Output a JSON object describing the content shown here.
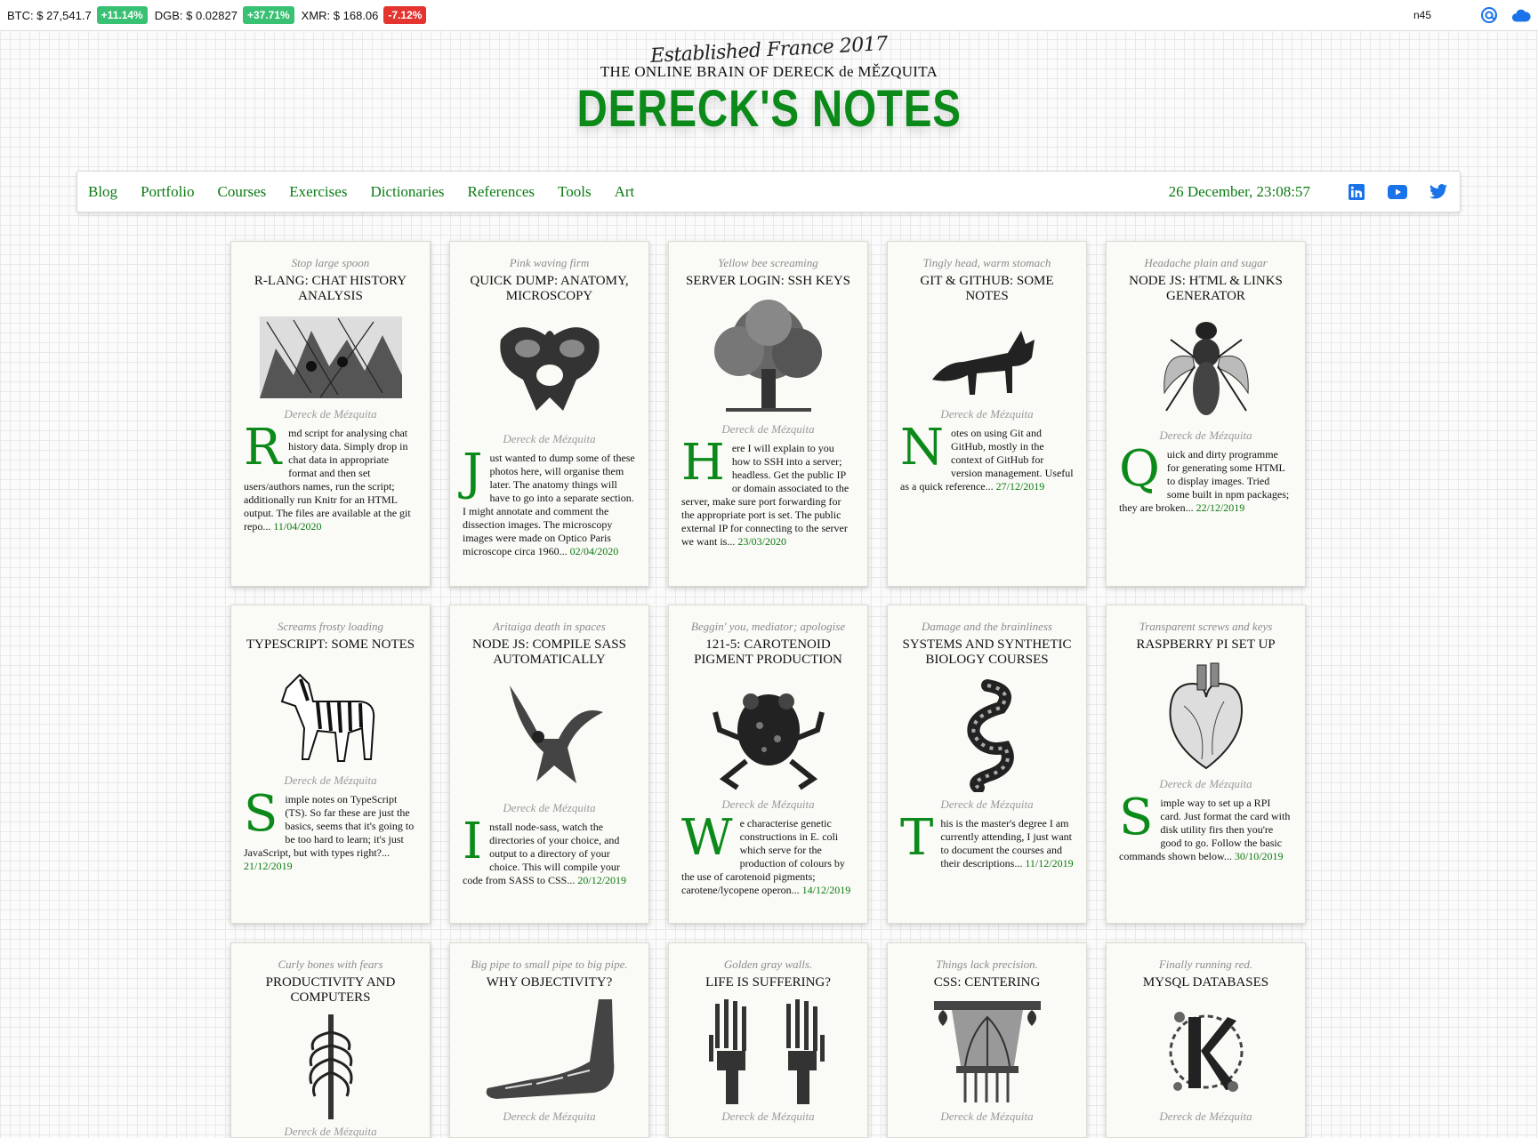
{
  "ticker": {
    "items": [
      {
        "label": "BTC: $ 27,541.7",
        "change": "+11.14%",
        "dir": "up"
      },
      {
        "label": "DGB: $ 0.02827",
        "change": "+37.71%",
        "dir": "up"
      },
      {
        "label": "XMR: $ 168.06",
        "change": "-7.12%",
        "dir": "down"
      }
    ],
    "user_code": "n45",
    "icons": [
      "at-icon",
      "cloud-icon"
    ]
  },
  "masthead": {
    "established": "Established France 2017",
    "subtitle": "THE ONLINE BRAIN OF DERECK de MĚZQUITA",
    "title": "DERECK'S NOTES"
  },
  "nav": {
    "links": [
      "Blog",
      "Portfolio",
      "Courses",
      "Exercises",
      "Dictionaries",
      "References",
      "Tools",
      "Art"
    ],
    "clock": "26 December, 23:08:57",
    "social_icons": [
      "linkedin-icon",
      "youtube-icon",
      "twitter-icon"
    ]
  },
  "colors": {
    "accent": "#0b8a1a",
    "link": "#0b7a12",
    "badge_up": "#38c172",
    "badge_down": "#e3342f",
    "social": "#1a73e8"
  },
  "cards": [
    {
      "tagline": "Stop large spoon",
      "title": "R-LANG: CHAT HISTORY ANALYSIS",
      "image": "jungle-scene",
      "author": "Dereck de Mézquita",
      "dropcap": "R",
      "text": "md script for analysing chat history data. Simply drop in chat data in appropriate format and then set users/authors names, run the script; additionally run Knitr for an HTML output. The files are available at the git repo...",
      "date": "11/04/2020"
    },
    {
      "tagline": "Pink waving firm",
      "title": "QUICK DUMP: ANATOMY, MICROSCOPY",
      "image": "pelvis-bone",
      "author": "Dereck de Mézquita",
      "dropcap": "J",
      "text": "ust wanted to dump some of these photos here, will organise them later. The anatomy things will have to go into a separate section. I might annotate and comment the dissection images. The microscopy images were made on Optico Paris microscope circa 1960...",
      "date": "02/04/2020"
    },
    {
      "tagline": "Yellow bee screaming",
      "title": "SERVER LOGIN: SSH KEYS",
      "image": "oak-tree",
      "author": "Dereck de Mézquita",
      "dropcap": "H",
      "text": "ere I will explain to you how to SSH into a server; headless. Get the public IP or domain associated to the server, make sure port forwarding for the appropriate port is set. The public external IP for connecting to the server we want is...",
      "date": "23/03/2020"
    },
    {
      "tagline": "Tingly head, warm stomach",
      "title": "GIT & GITHUB: SOME NOTES",
      "image": "fox",
      "author": "Dereck de Mézquita",
      "dropcap": "N",
      "text": "otes on using Git and GitHub, mostly in the context of GitHub for version management. Useful as a quick reference...",
      "date": "27/12/2019"
    },
    {
      "tagline": "Headache plain and sugar",
      "title": "NODE JS: HTML & LINKS GENERATOR",
      "image": "bee",
      "author": "Dereck de Mézquita",
      "dropcap": "Q",
      "text": "uick and dirty programme for generating some HTML to display images. Tried some built in npm packages; they are broken...",
      "date": "22/12/2019"
    },
    {
      "tagline": "Screams frosty loading",
      "title": "TYPESCRIPT: SOME NOTES",
      "image": "zebra",
      "author": "Dereck de Mézquita",
      "dropcap": "S",
      "text": "imple notes on TypeScript (TS). So far these are just the basics, seems that it's going to be too hard to learn; it's just JavaScript, but with types right?...",
      "date": "21/12/2019"
    },
    {
      "tagline": "Aritaiga death in spaces",
      "title": "NODE JS: COMPILE SASS AUTOMATICALLY",
      "image": "eagle",
      "author": "Dereck de Mézquita",
      "dropcap": "I",
      "text": "nstall node-sass, watch the directories of your choice, and output to a directory of your choice. This will compile your code from SASS to CSS...",
      "date": "20/12/2019"
    },
    {
      "tagline": "Beggin' you, mediator; apologise",
      "title": "121-5: CAROTENOID PIGMENT PRODUCTION",
      "image": "frog",
      "author": "Dereck de Mézquita",
      "dropcap": "W",
      "text": "e characterise genetic constructions in E. coli which serve for the production of colours by the use of carotenoid pigments; carotene/lycopene operon...",
      "date": "14/12/2019"
    },
    {
      "tagline": "Damage and the brainliness",
      "title": "SYSTEMS AND SYNTHETIC BIOLOGY COURSES",
      "image": "snake",
      "author": "Dereck de Mézquita",
      "dropcap": "T",
      "text": "his is the master's degree I am currently attending, I just want to document the courses and their descriptions...",
      "date": "11/12/2019"
    },
    {
      "tagline": "Transparent screws and keys",
      "title": "RASPBERRY PI SET UP",
      "image": "heart",
      "author": "Dereck de Mézquita",
      "dropcap": "S",
      "text": "imple way to set up a RPI card. Just format the card with disk utility firs then you're good to go. Follow the basic commands shown below...",
      "date": "30/10/2019"
    },
    {
      "tagline": "Curly bones with fears",
      "title": "PRODUCTIVITY AND COMPUTERS",
      "image": "ribcage",
      "author": "Dereck de Mézquita",
      "dropcap": "",
      "text": "",
      "date": ""
    },
    {
      "tagline": "Big pipe to small pipe to big pipe.",
      "title": "WHY OBJECTIVITY?",
      "image": "foot-bones",
      "author": "Dereck de Mézquita",
      "dropcap": "",
      "text": "",
      "date": ""
    },
    {
      "tagline": "Golden gray walls.",
      "title": "LIFE IS SUFFERING?",
      "image": "hand-bones",
      "author": "Dereck de Mézquita",
      "dropcap": "",
      "text": "",
      "date": ""
    },
    {
      "tagline": "Things lack precision.",
      "title": "CSS: CENTERING",
      "image": "column-capital",
      "author": "Dereck de Mézquita",
      "dropcap": "",
      "text": "",
      "date": ""
    },
    {
      "tagline": "Finally running red.",
      "title": "MYSQL DATABASES",
      "image": "ornate-letter-k",
      "author": "Dereck de Mézquita",
      "dropcap": "",
      "text": "",
      "date": ""
    }
  ]
}
